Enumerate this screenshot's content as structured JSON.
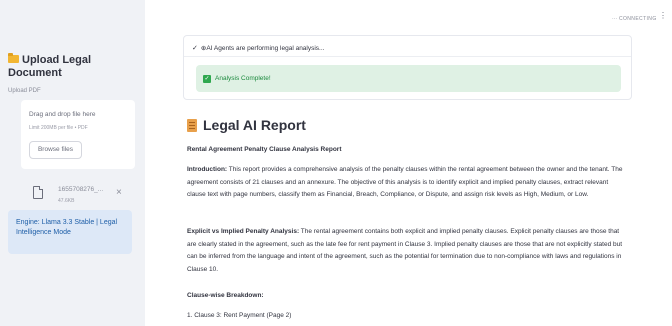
{
  "sidebar": {
    "title": "Upload Legal Document",
    "upload_label": "Upload PDF",
    "dropzone": {
      "main": "Drag and drop file here",
      "limit": "Limit 200MB per file • PDF",
      "browse": "Browse files"
    },
    "file": {
      "name": "1655708276_...",
      "size": "47.6KB"
    },
    "engine_text": "Engine: Llama 3.3 Stable | Legal Intelligence Mode"
  },
  "topbar": {
    "status": "CONNECTING"
  },
  "status_box": {
    "header": "AI Agents are performing legal analysis...",
    "success": "Analysis Complete!"
  },
  "report": {
    "title": "Legal AI Report",
    "subtitle": "Rental Agreement Penalty Clause Analysis Report",
    "intro_label": "Introduction:",
    "intro_text": " This report provides a comprehensive analysis of the penalty clauses within the rental agreement between the owner and the tenant. The agreement consists of 21 clauses and an annexure. The objective of this analysis is to identify explicit and implied penalty clauses, extract relevant clause text with page numbers, classify them as Financial, Breach, Compliance, or Dispute, and assign risk levels as High, Medium, or Low.",
    "explicit_label": "Explicit vs Implied Penalty Analysis:",
    "explicit_text": " The rental agreement contains both explicit and implied penalty clauses. Explicit penalty clauses are those that are clearly stated in the agreement, such as the late fee for rent payment in Clause 3. Implied penalty clauses are those that are not explicitly stated but can be inferred from the language and intent of the agreement, such as the potential for termination due to non-compliance with laws and regulations in Clause 10.",
    "breakdown_label": "Clause-wise Breakdown:",
    "list_item_1": "1. Clause 3: Rent Payment (Page 2)"
  },
  "colors": {
    "sidebar_bg": "#f0f2f6",
    "success_bg": "#dff1e4",
    "success_text": "#1c8a3e",
    "info_bg": "#dde8f7",
    "info_text": "#1f5fa8"
  }
}
